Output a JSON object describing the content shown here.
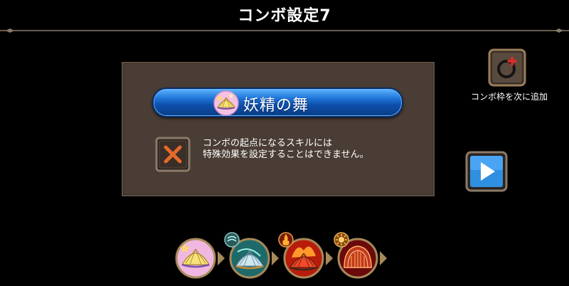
{
  "header": {
    "title": "コンボ設定7"
  },
  "panel": {
    "skill_name": "妖精の舞",
    "skill_icon": "fan-fairy-icon",
    "warning_line1": "コンボの起点になるスキルには",
    "warning_line2": "特殊効果を設定することはできません。",
    "warning_icon": "cross-icon"
  },
  "side": {
    "add_label": "コンボ枠を次に追加",
    "add_icon": "ring-plus-icon",
    "next_icon": "play-icon"
  },
  "combo_slots": [
    {
      "icon": "fan-fairy-icon",
      "badge": ""
    },
    {
      "icon": "fan-wind-icon",
      "badge": "wind-badge-icon"
    },
    {
      "icon": "fan-fire-icon",
      "badge": "fire-badge-icon"
    },
    {
      "icon": "dome-icon",
      "badge": "sun-badge-icon"
    }
  ],
  "colors": {
    "accent_blue": "#1f75d8",
    "panel": "#4a3d35",
    "gold": "#b8924a"
  }
}
